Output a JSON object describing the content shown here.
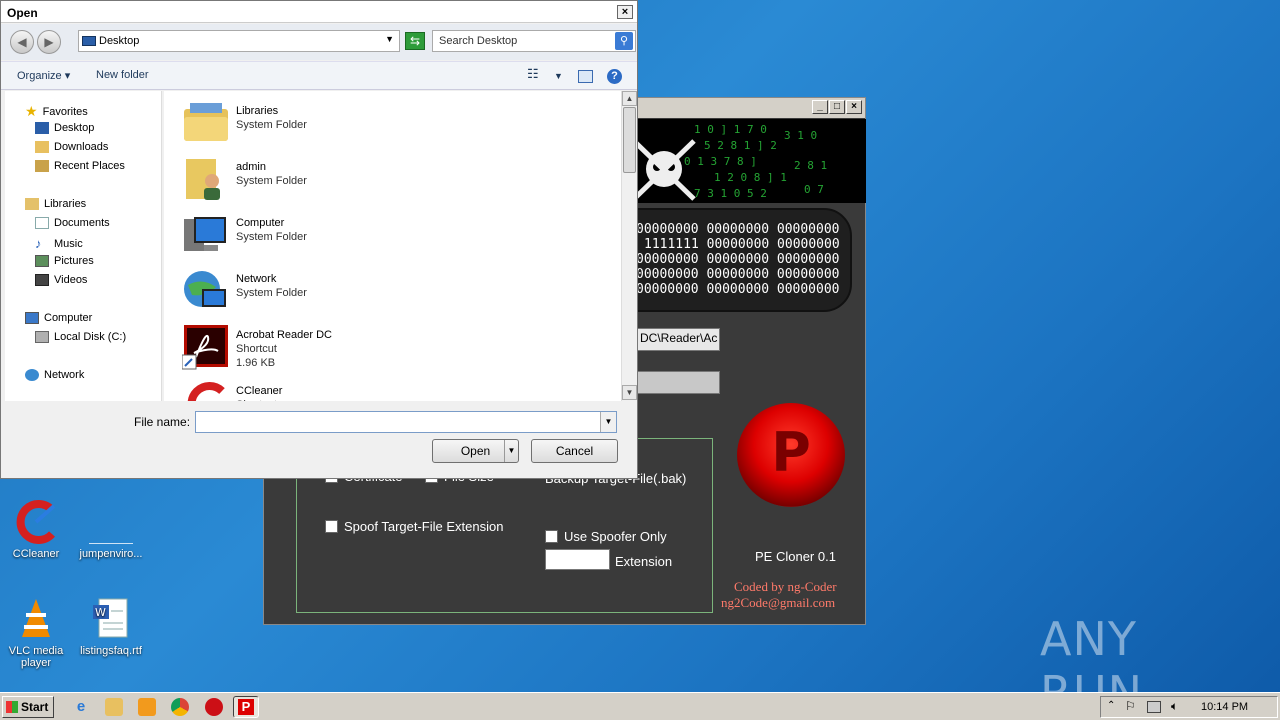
{
  "desktop": {
    "icons": [
      {
        "label": "CCleaner"
      },
      {
        "label": "jumpenviro..."
      },
      {
        "label": "VLC media player"
      },
      {
        "label": "listingsfaq.rtf"
      }
    ],
    "watermark": "ANY RUN"
  },
  "pe_cloner": {
    "binary_lines": [
      "00000000 00000000 00000000",
      "1111111 00000000 00000000",
      "00000000 00000000 00000000",
      "00000000 00000000 00000000",
      "00000000 00000000 00000000"
    ],
    "path_field": "DC\\Reader\\Ac",
    "path_field2": "",
    "checkboxes": {
      "certificate": "Certificate",
      "file_size": "File Size",
      "backup": "Backup Target-File(.bak)",
      "spoof": "Spoof Target-File Extension",
      "use_spoofer": "Use Spoofer Only",
      "extension": "Extension"
    },
    "big_button_letter": "P",
    "version": "PE Cloner 0.1",
    "credit1": "Coded by ng-Coder",
    "credit2": "ng2Code@gmail.com"
  },
  "dialog": {
    "title": "Open",
    "address": "Desktop",
    "search_placeholder": "Search Desktop",
    "toolbar": {
      "organize": "Organize",
      "new_folder": "New folder"
    },
    "nav": {
      "favorites": "Favorites",
      "desktop": "Desktop",
      "downloads": "Downloads",
      "recent": "Recent Places",
      "libraries": "Libraries",
      "documents": "Documents",
      "music": "Music",
      "pictures": "Pictures",
      "videos": "Videos",
      "computer": "Computer",
      "local_disk": "Local Disk (C:)",
      "network": "Network"
    },
    "files": [
      {
        "name": "Libraries",
        "type": "System Folder",
        "size": ""
      },
      {
        "name": "admin",
        "type": "System Folder",
        "size": ""
      },
      {
        "name": "Computer",
        "type": "System Folder",
        "size": ""
      },
      {
        "name": "Network",
        "type": "System Folder",
        "size": ""
      },
      {
        "name": "Acrobat Reader DC",
        "type": "Shortcut",
        "size": "1.96 KB"
      },
      {
        "name": "CCleaner",
        "type": "Shortcut",
        "size": ""
      }
    ],
    "file_name_label": "File name:",
    "file_name_value": "",
    "open_label": "Open",
    "cancel_label": "Cancel"
  },
  "taskbar": {
    "start": "Start",
    "clock": "10:14 PM"
  }
}
